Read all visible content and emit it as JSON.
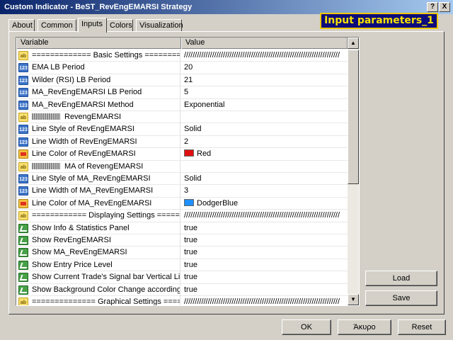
{
  "window": {
    "title": "Custom Indicator - BeST_RevEngEMARSI Strategy",
    "help_button": "?",
    "close_button": "X"
  },
  "banner": "Input parameters_1",
  "tabs": [
    {
      "label": "About",
      "active": false
    },
    {
      "label": "Common",
      "active": false
    },
    {
      "label": "Inputs",
      "active": true
    },
    {
      "label": "Colors",
      "active": false
    },
    {
      "label": "Visualization",
      "active": false
    }
  ],
  "grid": {
    "headers": {
      "variable": "Variable",
      "value": "Value"
    },
    "rows": [
      {
        "icon": "ab",
        "variable": "============= Basic Settings ==========",
        "value": "////////////////////////////////////////////////////////////////////////"
      },
      {
        "icon": "123",
        "variable": "EMA LB Period",
        "value": "20"
      },
      {
        "icon": "123",
        "variable": "Wilder (RSI) LB Period",
        "value": "21"
      },
      {
        "icon": "123",
        "variable": "MA_RevEngEMARSI LB Period",
        "value": "5"
      },
      {
        "icon": "123",
        "variable": "MA_RevEngEMARSI Method",
        "value": "Exponential"
      },
      {
        "icon": "ab",
        "variable": "RevengEMARSI",
        "value": "",
        "bar": true
      },
      {
        "icon": "123",
        "variable": "Line Style of RevEngEMARSI",
        "value": "Solid"
      },
      {
        "icon": "123",
        "variable": "Line Width of RevEngEMARSI",
        "value": "2"
      },
      {
        "icon": "color",
        "variable": "Line Color of RevEngEMARSI",
        "value": "Red",
        "swatch": "#e01010"
      },
      {
        "icon": "ab",
        "variable": "MA of RevengEMARSI",
        "value": "",
        "bar": true
      },
      {
        "icon": "123",
        "variable": "Line Style of MA_RevEngEMARSI",
        "value": "Solid"
      },
      {
        "icon": "123",
        "variable": "Line Width of MA_RevEngEMARSI",
        "value": "3"
      },
      {
        "icon": "color",
        "variable": "Line Color of MA_RevEngEMARSI",
        "value": "DodgerBlue",
        "swatch": "#1e90ff"
      },
      {
        "icon": "ab",
        "variable": "============ Displaying Settings =====",
        "value": "////////////////////////////////////////////////////////////////////////"
      },
      {
        "icon": "bool",
        "variable": "Show Info & Statistics Panel",
        "value": "true"
      },
      {
        "icon": "bool",
        "variable": "Show RevEngEMARSI",
        "value": "true"
      },
      {
        "icon": "bool",
        "variable": "Show MA_RevEngEMARSI",
        "value": "true"
      },
      {
        "icon": "bool",
        "variable": "Show Entry Price Level",
        "value": "true"
      },
      {
        "icon": "bool",
        "variable": "Show Current Trade's Signal bar Vertical Line",
        "value": "true"
      },
      {
        "icon": "bool",
        "variable": "Show Background Color Change according to signal",
        "value": "true"
      },
      {
        "icon": "ab",
        "variable": "============== Graphical Settings =====",
        "value": "////////////////////////////////////////////////////////////////////////"
      }
    ]
  },
  "side_buttons": {
    "load": "Load",
    "save": "Save"
  },
  "footer_buttons": {
    "ok": "OK",
    "cancel": "Άκυρο",
    "reset": "Reset"
  }
}
